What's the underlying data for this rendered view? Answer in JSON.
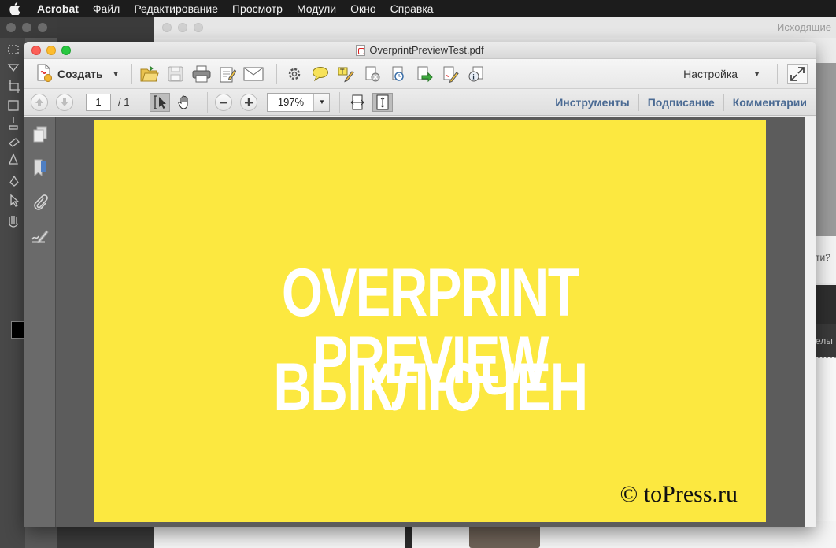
{
  "menubar": {
    "app_name": "Acrobat",
    "items": [
      "Файл",
      "Редактирование",
      "Просмотр",
      "Модули",
      "Окно",
      "Справка"
    ]
  },
  "background_window": {
    "title": "Исходящие",
    "fragments": [
      "ти?",
      "елы"
    ]
  },
  "acrobat": {
    "title": "OverprintPreviewTest.pdf",
    "toolbar": {
      "create_label": "Создать",
      "settings_label": "Настройка"
    },
    "nav": {
      "current_page": "1",
      "page_total": "/ 1",
      "zoom": "197%"
    },
    "panels": [
      "Инструменты",
      "Подписание",
      "Комментарии"
    ]
  },
  "document": {
    "page_color": "#fce840",
    "headline_line1": "OVERPRINT PREVIEW",
    "headline_line2": "ВЫКЛЮЧЕН",
    "watermark": "© toPress.ru"
  },
  "colors": {
    "traffic_close": "#fc5f57",
    "traffic_min": "#fdbc2e",
    "traffic_max": "#28c840",
    "panel_link": "#4a6a93"
  },
  "icons": [
    "apple-icon",
    "create-pdf-icon",
    "open-icon",
    "save-icon",
    "print-icon",
    "edit-icon",
    "email-icon",
    "gear-icon",
    "comment-icon",
    "highlight-icon",
    "delete-icon",
    "scan-icon",
    "export-icon",
    "sign-icon",
    "info-icon",
    "expand-icon",
    "prev-page-icon",
    "next-page-icon",
    "select-tool-icon",
    "hand-tool-icon",
    "zoom-out-icon",
    "zoom-in-icon",
    "fit-width-icon",
    "fit-page-icon",
    "pages-icon",
    "bookmark-icon",
    "attachment-icon",
    "signature-panel-icon"
  ]
}
